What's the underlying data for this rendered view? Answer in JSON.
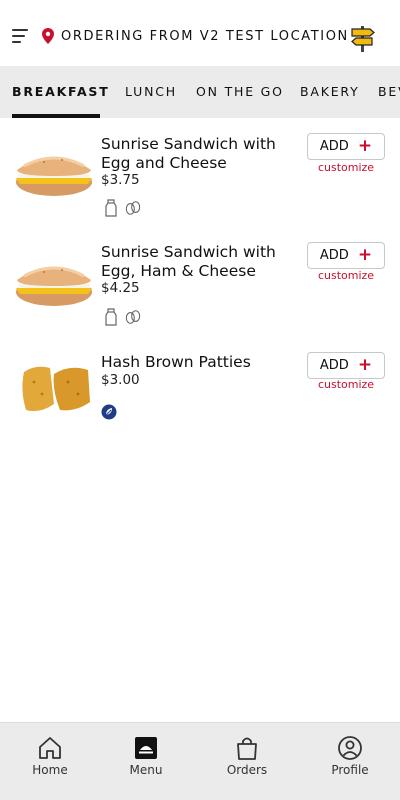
{
  "header": {
    "location": "ORDERING FROM V2 TEST LOCATION",
    "menu_icon": "hamburger-icon",
    "pin_icon": "location-pin-icon",
    "signpost_icon": "signpost-icon"
  },
  "tabs": [
    {
      "label": "BREAKFAST",
      "active": true
    },
    {
      "label": "LUNCH",
      "active": false
    },
    {
      "label": "ON THE GO",
      "active": false
    },
    {
      "label": "BAKERY",
      "active": false
    },
    {
      "label": "BEV",
      "active": false
    }
  ],
  "items": [
    {
      "name": "Sunrise Sandwich with Egg and Cheese",
      "price": "$3.75",
      "add_label": "ADD",
      "customize_label": "customize",
      "diet_icons": [
        "dairy-icon",
        "egg-icon"
      ]
    },
    {
      "name": "Sunrise Sandwich with Egg, Ham & Cheese",
      "price": "$4.25",
      "add_label": "ADD",
      "customize_label": "customize",
      "diet_icons": [
        "dairy-icon",
        "egg-icon"
      ]
    },
    {
      "name": "Hash Brown Patties",
      "price": "$3.00",
      "add_label": "ADD",
      "customize_label": "customize",
      "diet_icons": [
        "vegan-icon"
      ]
    }
  ],
  "nav": [
    {
      "label": "Home",
      "icon": "home-icon",
      "active": false
    },
    {
      "label": "Menu",
      "icon": "menu-icon",
      "active": true
    },
    {
      "label": "Orders",
      "icon": "shopping-bag-icon",
      "active": false
    },
    {
      "label": "Profile",
      "icon": "profile-icon",
      "active": false
    }
  ],
  "colors": {
    "accent": "#c8102e",
    "tab_bar": "#ebebeb",
    "signpost": "#f2b90f",
    "vegan_badge": "#1f3c88"
  }
}
